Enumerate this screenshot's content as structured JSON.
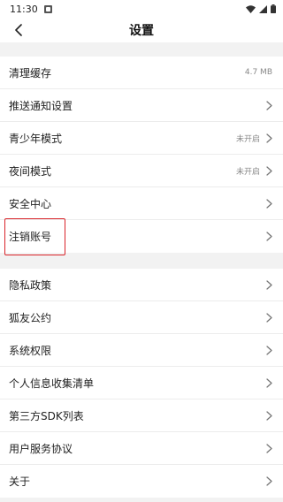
{
  "status_bar": {
    "time": "11:30"
  },
  "header": {
    "title": "设置"
  },
  "group1": [
    {
      "label": "清理缓存",
      "value": "4.7 MB",
      "chevron": false
    },
    {
      "label": "推送通知设置",
      "value": "",
      "chevron": true
    },
    {
      "label": "青少年模式",
      "value": "未开启",
      "chevron": true
    },
    {
      "label": "夜间模式",
      "value": "未开启",
      "chevron": true
    },
    {
      "label": "安全中心",
      "value": "",
      "chevron": true
    },
    {
      "label": "注销账号",
      "value": "",
      "chevron": true
    }
  ],
  "group2": [
    {
      "label": "隐私政策",
      "chevron": true
    },
    {
      "label": "狐友公约",
      "chevron": true
    },
    {
      "label": "系统权限",
      "chevron": true
    },
    {
      "label": "个人信息收集清单",
      "chevron": true
    },
    {
      "label": "第三方SDK列表",
      "chevron": true
    },
    {
      "label": "用户服务协议",
      "chevron": true
    },
    {
      "label": "关于",
      "chevron": true
    }
  ],
  "colors": {
    "highlight": "#d9242a",
    "background": "#f2f2f2"
  },
  "icons": {
    "back": "chevron-left-icon",
    "row": "chevron-right-icon"
  }
}
